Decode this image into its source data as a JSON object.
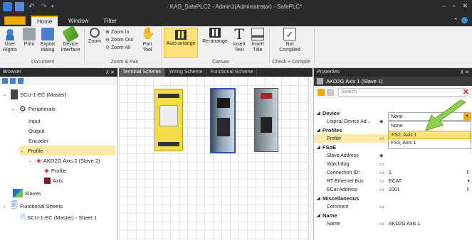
{
  "window": {
    "title": "KAS_SafePLC2 - Admin1(Administrator) - SafePLC*"
  },
  "ribbon_tabs": [
    {
      "label": "Home"
    },
    {
      "label": "Window"
    },
    {
      "label": "Filter"
    }
  ],
  "ribbon": {
    "buttons": {
      "user_rights": "User Rights",
      "print": "Print",
      "export_dialog": "Export dialog",
      "device_interface": "Device Interface",
      "zoom": "Zoom",
      "zoom_in": "Zoom In",
      "zoom_out": "Zoom Out",
      "zoom_all": "Zoom All",
      "pan_tool": "Pan Tool",
      "auto_arrange": "Auto-arrange",
      "re_arrange": "Re-arrange",
      "insert_text": "Insert Text",
      "insert_title": "Insert Title",
      "not_compiled": "Not Compiled"
    },
    "groups": {
      "document": "Document",
      "zoom_pan": "Zoom & Pan",
      "canvas": "Canvas",
      "check_compile": "Check + Compile"
    }
  },
  "browser": {
    "title": "Browser",
    "tree": {
      "master": "SCU-1-EC (Master)",
      "peripherals": "Peripherals",
      "input": "Input",
      "output": "Output",
      "encoder": "Encoder",
      "profile": "Profile",
      "axis2": "AKD2G Axis 2 (Slave 2)",
      "axis2_profile": "Profile",
      "axis2_axis": "Axis",
      "slaves": "Slaves",
      "functional_sheets": "Functional Sheets",
      "sheet1": "SCU-1-EC (Master) - Sheet 1"
    }
  },
  "center_tabs": [
    {
      "label": "Terminal Scheme"
    },
    {
      "label": "Wiring Scheme"
    },
    {
      "label": "Functional Scheme"
    }
  ],
  "properties": {
    "title": "Properties",
    "subject": "AKD2G Axis 1 (Slave 1)",
    "search_placeholder": "Search",
    "categories": {
      "device": "Device",
      "profiles": "Profiles",
      "fsoe": "FSoE",
      "misc": "Miscellaneous",
      "name": "Name"
    },
    "rows": {
      "logical_device": {
        "label": "Logical Device Ad...",
        "value": "1"
      },
      "profile": {
        "label": "Profile",
        "value": "None"
      },
      "slave_address": {
        "label": "Slave Address",
        "value": ""
      },
      "watchdog": {
        "label": "Watchdog",
        "value": ""
      },
      "connection_id": {
        "label": "Connection ID:",
        "value": "1"
      },
      "rt_ethernet_bus": {
        "label": "RT Ethernet Bus",
        "value": "ECAT"
      },
      "ecat_address": {
        "label": "ECat Address",
        "value": "1001"
      },
      "comment": {
        "label": "Comment",
        "value": ""
      },
      "name": {
        "label": "Name",
        "value": "AKD2G Axis 1"
      }
    },
    "dropdown_options": [
      "None",
      "FS2, Axis 1",
      "FS3, Axis 1"
    ],
    "dropdown_selected_index": 1
  },
  "colors": {
    "accent": "#f2a900",
    "dark_chrome": "#2b2b2b",
    "selection": "#ffe27a",
    "arrow_green": "#8fd14f"
  }
}
